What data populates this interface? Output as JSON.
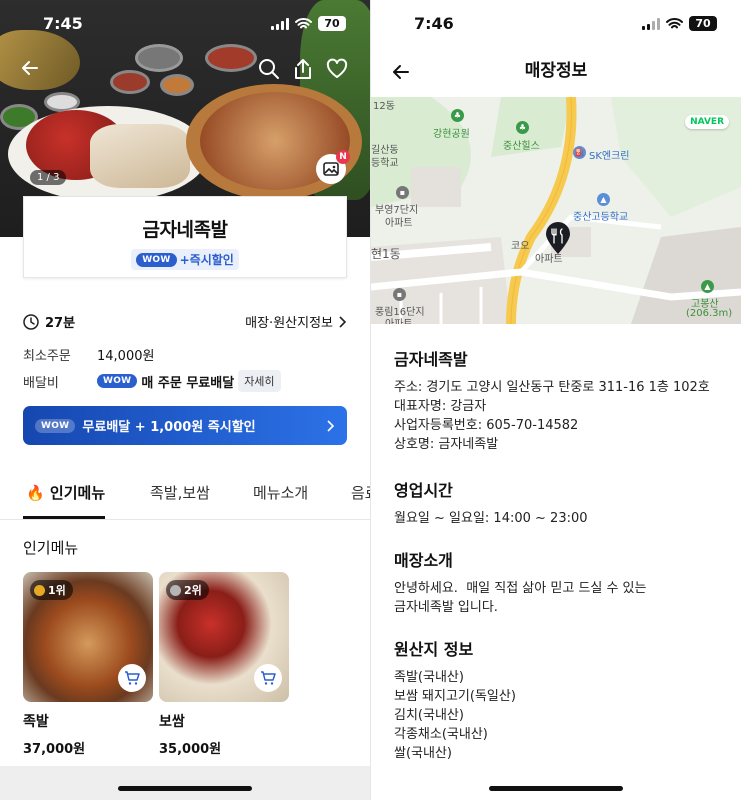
{
  "left": {
    "status": {
      "time": "7:45",
      "battery": "70"
    },
    "hero": {
      "counter": "1 / 3",
      "badge": "N"
    },
    "store": {
      "name": "금자네족발",
      "wow": "WOW",
      "wow_text": "+즉시할인"
    },
    "delivery_time": "27분",
    "store_info_link": "매장·원산지정보",
    "min_order_label": "최소주문",
    "min_order_value": "14,000원",
    "delivery_fee_label": "배달비",
    "delivery_wow": "WOW",
    "delivery_fee_value": "매 주문 무료배달",
    "detail_button": "자세히",
    "promo": {
      "wow": "WOW",
      "text": "무료배달 + 1,000원 즉시할인"
    },
    "tabs": [
      {
        "label": "인기메뉴",
        "active": true
      },
      {
        "label": "족발,보쌈",
        "active": false
      },
      {
        "label": "메뉴소개",
        "active": false
      },
      {
        "label": "음료",
        "active": false
      }
    ],
    "section_title": "인기메뉴",
    "menu": [
      {
        "rank": "1위",
        "name": "족발",
        "price": "37,000원"
      },
      {
        "rank": "2위",
        "name": "보쌈",
        "price": "35,000원"
      }
    ]
  },
  "right": {
    "status": {
      "time": "7:46",
      "battery": "70"
    },
    "title": "매장정보",
    "map": {
      "brand": "NAVER",
      "labels": [
        "12동",
        "강현공원",
        "중산힐스",
        "SK엔크린",
        "길산동",
        "등학교",
        "부영7단지",
        "아파트",
        "중산고등학교",
        "코오",
        "아파트",
        "현1동",
        "풍림16단지",
        "아파트",
        "고봉산",
        "(206.3m)"
      ]
    },
    "store": {
      "name": "금자네족발",
      "address": "주소: 경기도 고양시 일산동구 탄중로 311-16 1층 102호",
      "owner": "대표자명: 강금자",
      "biz_no": "사업자등록번호: 605-70-14582",
      "trade_name": "상호명: 금자네족발"
    },
    "hours": {
      "title": "영업시간",
      "text": "월요일 ~ 일요일: 14:00 ~ 23:00"
    },
    "intro": {
      "title": "매장소개",
      "line1": "안녕하세요.  매일 직접 삶아 믿고 드실 수 있는",
      "line2": "금자네족발 입니다."
    },
    "origin": {
      "title": "원산지 정보",
      "items": [
        "족발(국내산)",
        "보쌈 돼지고기(독일산)",
        "김치(국내산)",
        "각종채소(국내산)",
        "쌀(국내산)"
      ]
    }
  },
  "colors": {
    "wow_blue": "#2c5fce",
    "promo_start": "#1647b0",
    "promo_end": "#2c72e8",
    "badge_red": "#e8384f",
    "naver_green": "#03c75a"
  }
}
